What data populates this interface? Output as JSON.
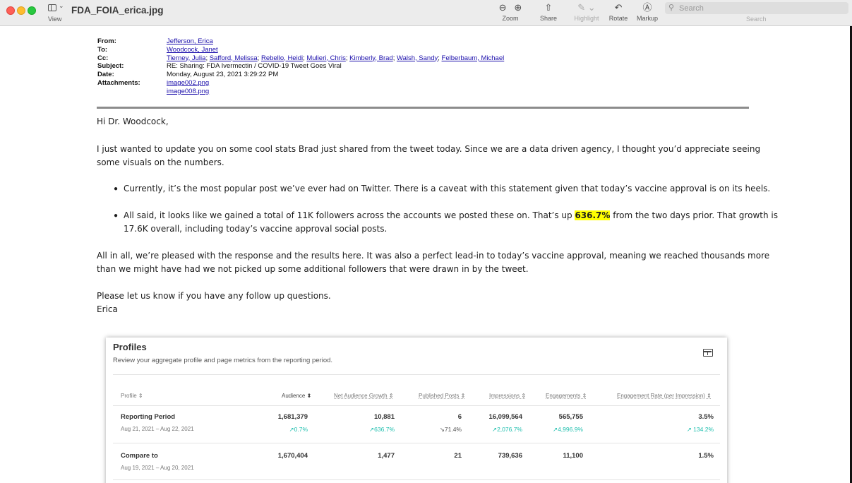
{
  "window": {
    "title": "FDA_FOIA_erica.jpg",
    "view_label": "View",
    "toolbar": {
      "zoom_label": "Zoom",
      "share_label": "Share",
      "highlight_label": "Highlight",
      "rotate_label": "Rotate",
      "markup_label": "Markup",
      "search_placeholder": "Search",
      "search_label": "Search"
    }
  },
  "email": {
    "header": {
      "from_key": "From:",
      "from": "Jefferson, Erica",
      "to_key": "To:",
      "to": "Woodcock, Janet",
      "cc_key": "Cc:",
      "cc": [
        "Tierney, Julia",
        "Safford, Melissa",
        "Rebello, Heidi",
        "Mulieri, Chris",
        "Kimberly, Brad",
        "Walsh, Sandy",
        "Felberbaum, Michael"
      ],
      "cc_separator": ";",
      "subject_key": "Subject:",
      "subject": "RE: Sharing: FDA Ivermectin / COVID-19 Tweet Goes Viral",
      "date_key": "Date:",
      "date": "Monday, August 23, 2021 3:29:22 PM",
      "attachments_key": "Attachments:",
      "attachments": [
        "image002.png",
        "image008.png"
      ]
    },
    "greeting": "Hi Dr. Woodcock,",
    "para1_line1": "I just wanted to update you on some cool stats Brad just shared from the tweet today. Since we are a data driven agency, I thought you’d appreciate seeing",
    "para1_line2": "some visuals on the numbers.",
    "bullet1": "Currently, it’s the most popular post we’ve ever had on Twitter. There is a caveat with this statement given that today’s vaccine approval is on its heels.",
    "bullet2_pre": "All said, it looks like we gained a total of 11K followers across the accounts we posted these on. That’s up ",
    "bullet2_highlight": "636.7%",
    "bullet2_post": " from the two days prior. That growth is",
    "bullet2_line2": "17.6K overall, including today’s vaccine approval social posts.",
    "para2_line1": "All in all, we’re pleased with the response and the results here. It was also a perfect lead-in to today’s vaccine approval, meaning we reached thousands more",
    "para2_line2": "than we might have had we not picked up some additional followers that were drawn in by the tweet.",
    "closing_line1": "Please let us know if you have any follow up questions.",
    "signature": "Erica"
  },
  "profiles_card": {
    "title": "Profiles",
    "subtitle": "Review your aggregate profile and page metrics from the reporting period.",
    "columns": [
      "Profile ⇕",
      "Audience ⬍",
      "Net Audience Growth ⇕",
      "Published Posts ⇕",
      "Impressions ⇕",
      "Engagements ⇕",
      "Engagement Rate (per Impression) ⇕"
    ],
    "rows": [
      {
        "name": "Reporting Period",
        "dates": "Aug 21, 2021 – Aug 22, 2021",
        "audience": "1,681,379",
        "net_growth": "10,881",
        "posts": "6",
        "impressions": "16,099,564",
        "engagements": "565,755",
        "rate": "3.5%",
        "audience_chg": "↗0.7%",
        "net_growth_chg": "↗636.7%",
        "posts_chg": "↘71.4%",
        "impressions_chg": "↗2,076.7%",
        "engagements_chg": "↗4,996.9%",
        "rate_chg": "↗ 134.2%"
      },
      {
        "name": "Compare to",
        "dates": "Aug 19, 2021 – Aug 20, 2021",
        "audience": "1,670,404",
        "net_growth": "1,477",
        "posts": "21",
        "impressions": "739,636",
        "engagements": "11,100",
        "rate": "1.5%"
      }
    ]
  }
}
